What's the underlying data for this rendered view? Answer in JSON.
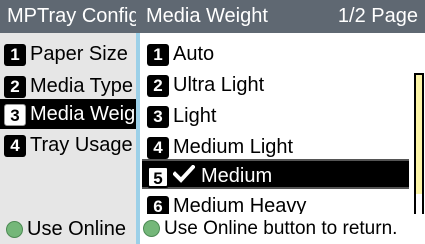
{
  "back_window": {
    "title": "MPTray Config",
    "items": [
      {
        "num": "1",
        "label": "Paper Size"
      },
      {
        "num": "2",
        "label": "Media Type"
      },
      {
        "num": "3",
        "label": "Media Weight"
      },
      {
        "num": "4",
        "label": "Tray Usage"
      }
    ],
    "footer": "Use Online"
  },
  "front_window": {
    "title": "Media Weight",
    "page": "1/2 Page",
    "items": [
      {
        "num": "1",
        "label": "Auto"
      },
      {
        "num": "2",
        "label": "Ultra Light"
      },
      {
        "num": "3",
        "label": "Light"
      },
      {
        "num": "4",
        "label": "Medium Light"
      },
      {
        "num": "5",
        "label": "Medium"
      },
      {
        "num": "6",
        "label": "Medium Heavy"
      }
    ],
    "footer": "Use Online button to return."
  },
  "colors": {
    "title_bar": "#5f6872",
    "accent_border": "#9cd0e8",
    "scroll_thumb": "#fbf4a6",
    "online_led": "#74b779"
  }
}
